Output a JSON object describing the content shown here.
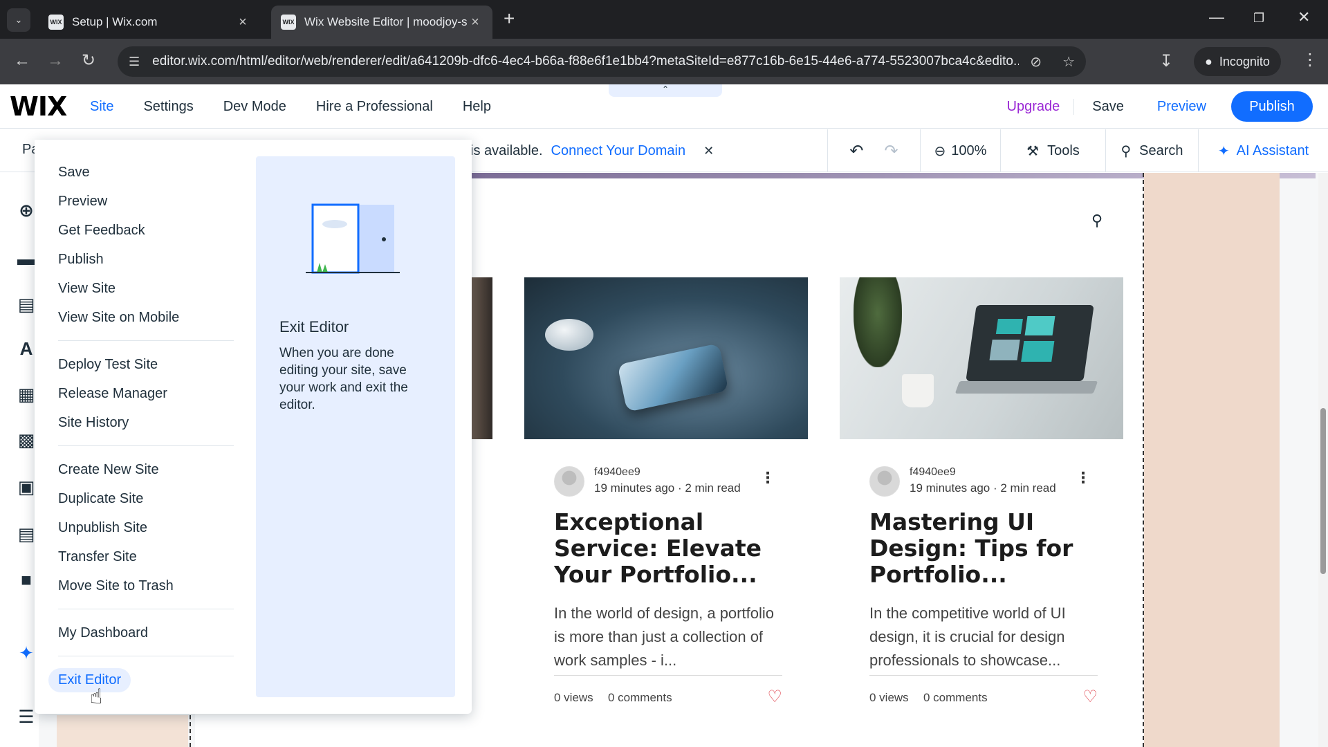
{
  "browser": {
    "tabs": [
      {
        "title": "Setup | Wix.com",
        "favicon": "WIX",
        "active": false
      },
      {
        "title": "Wix Website Editor | moodjoy-s",
        "favicon": "WIX",
        "active": true
      }
    ],
    "url": "editor.wix.com/html/editor/web/renderer/edit/a641209b-dfc6-4ec4-b66a-f88e6f1e1bb4?metaSiteId=e877c16b-6e15-44e6-a774-5523007bca4c&edito...",
    "incognito_label": "Incognito"
  },
  "wix_header": {
    "logo": "WIX",
    "menu": [
      "Site",
      "Settings",
      "Dev Mode",
      "Hire a Professional",
      "Help"
    ],
    "upgrade": "Upgrade",
    "save": "Save",
    "preview": "Preview",
    "publish": "Publish"
  },
  "toolbar": {
    "pages_label": "Pa",
    "domain_text": "is available.",
    "connect_domain": "Connect Your Domain",
    "zoom": "100%",
    "tools": "Tools",
    "search": "Search",
    "ai_assistant": "AI Assistant"
  },
  "site_menu": {
    "group1": [
      "Save",
      "Preview",
      "Get Feedback",
      "Publish",
      "View Site",
      "View Site on Mobile"
    ],
    "group2": [
      "Deploy Test Site",
      "Release Manager",
      "Site History"
    ],
    "group3": [
      "Create New Site",
      "Duplicate Site",
      "Unpublish Site",
      "Transfer Site",
      "Move Site to Trash"
    ],
    "group4": [
      "My Dashboard"
    ],
    "group5": [
      "Exit Editor"
    ],
    "info": {
      "title": "Exit Editor",
      "description": "When you are done editing your site, save your work and exit the editor."
    }
  },
  "posts": [
    {
      "author": "f4940ee9",
      "time": "19 minutes ago",
      "read": "2 min read",
      "title": "Exceptional Service: Elevate Your Portfolio...",
      "excerpt": "In the world of design, a portfolio is more than just a collection of work samples - i...",
      "views": "0 views",
      "comments": "0 comments"
    },
    {
      "author": "f4940ee9",
      "time": "19 minutes ago",
      "read": "2 min read",
      "title": "Mastering UI Design: Tips for Portfolio...",
      "excerpt": "In the competitive world of UI design, it is crucial for design professionals to showcase...",
      "views": "0 views",
      "comments": "0 comments"
    }
  ],
  "colors": {
    "accent": "#116dff",
    "upgrade": "#9a27d5",
    "heart": "#e0454f"
  }
}
